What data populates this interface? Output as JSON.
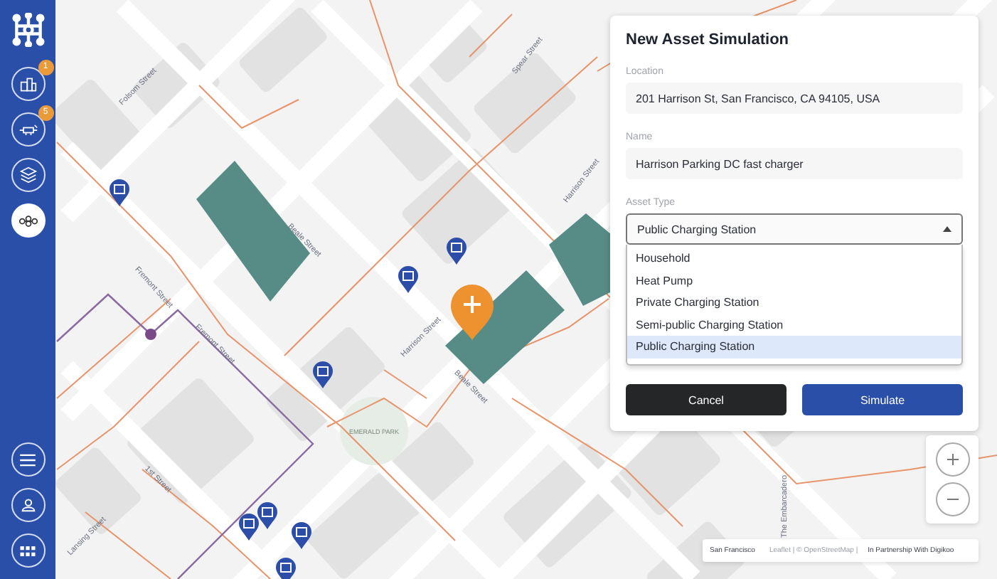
{
  "sidebar": {
    "top_items": [
      {
        "kind": "buildings",
        "badge": "1",
        "selected": false
      },
      {
        "kind": "charger",
        "badge": "5",
        "selected": false
      },
      {
        "kind": "layers",
        "selected": false
      },
      {
        "kind": "network",
        "selected": true
      }
    ],
    "bottom_items": [
      {
        "kind": "menu"
      },
      {
        "kind": "user"
      },
      {
        "kind": "grid"
      }
    ]
  },
  "map": {
    "street_labels": [
      "Folsom Street",
      "Spear Street",
      "Harrison Street",
      "Fremont Street",
      "Fremont Street",
      "Beale Street",
      "Beale Street",
      "Harrison Street",
      "1st Street",
      "Lansing Street",
      "The Embarcadero"
    ],
    "park_label": "EMERALD PARK",
    "attribution": {
      "place": "San Francisco",
      "credits": "Leaflet | © OpenStreetMap |",
      "partner": "In Partnership With Digikoo"
    }
  },
  "dialog": {
    "title": "New Asset Simulation",
    "fields": [
      {
        "label": "Location",
        "value": "201 Harrison St, San Francisco, CA 94105, USA"
      },
      {
        "label": "Name",
        "value": "Harrison Parking DC fast charger"
      }
    ],
    "asset_type": {
      "label": "Asset Type",
      "value": "Public Charging Station",
      "expanded": true,
      "options": [
        {
          "label": "Household",
          "selected": false
        },
        {
          "label": "Heat Pump",
          "selected": false
        },
        {
          "label": "Private Charging Station",
          "selected": false
        },
        {
          "label": "Semi-public Charging Station",
          "selected": false
        },
        {
          "label": "Public Charging Station",
          "selected": true
        }
      ]
    },
    "buttons": [
      {
        "label": "Cancel",
        "kind": "secondary"
      },
      {
        "label": "Simulate",
        "kind": "primary"
      }
    ]
  }
}
